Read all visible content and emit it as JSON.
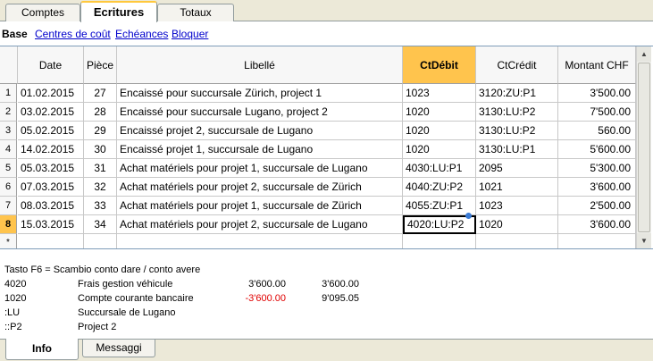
{
  "tabs": [
    {
      "label": "Comptes"
    },
    {
      "label": "Ecritures"
    },
    {
      "label": "Totaux"
    }
  ],
  "views": [
    {
      "label": "Base"
    },
    {
      "label": "Centres de coût"
    },
    {
      "label": "Echéances"
    },
    {
      "label": "Bloquer"
    }
  ],
  "columns": [
    "Date",
    "Pièce",
    "Libellé",
    "CtDébit",
    "CtCrédit",
    "Montant CHF"
  ],
  "rows": [
    {
      "n": "1",
      "date": "01.02.2015",
      "piece": "27",
      "libelle": "Encaissé pour succursale Zürich, project 1",
      "debit": "1023",
      "credit": "3120:ZU:P1",
      "montant": "3'500.00"
    },
    {
      "n": "2",
      "date": "03.02.2015",
      "piece": "28",
      "libelle": "Encaissé pour succursale Lugano, project 2",
      "debit": "1020",
      "credit": "3130:LU:P2",
      "montant": "7'500.00"
    },
    {
      "n": "3",
      "date": "05.02.2015",
      "piece": "29",
      "libelle": "Encaissé projet 2, succursale de Lugano",
      "debit": "1020",
      "credit": "3130:LU:P2",
      "montant": "560.00"
    },
    {
      "n": "4",
      "date": "14.02.2015",
      "piece": "30",
      "libelle": "Encaissé projet 1, succursale de Lugano",
      "debit": "1020",
      "credit": "3130:LU:P1",
      "montant": "5'600.00"
    },
    {
      "n": "5",
      "date": "05.03.2015",
      "piece": "31",
      "libelle": "Achat matériels pour projet 1, succursale de Lugano",
      "debit": "4030:LU:P1",
      "credit": "2095",
      "montant": "5'300.00"
    },
    {
      "n": "6",
      "date": "07.03.2015",
      "piece": "32",
      "libelle": "Achat matériels pour projet 2, succursale de Zürich",
      "debit": "4040:ZU:P2",
      "credit": "1021",
      "montant": "3'600.00"
    },
    {
      "n": "7",
      "date": "08.03.2015",
      "piece": "33",
      "libelle": "Achat matériels pour projet 1, succursale de Zürich",
      "debit": "4055:ZU:P1",
      "credit": "1023",
      "montant": "2'500.00"
    },
    {
      "n": "8",
      "date": "15.03.2015",
      "piece": "34",
      "libelle": "Achat matériels pour projet 2, succursale de Lugano",
      "debit": "4020:LU:P2",
      "credit": "1020",
      "montant": "3'600.00"
    }
  ],
  "new_row_marker": "*",
  "info": {
    "hint": "Tasto F6 = Scambio conto dare / conto avere",
    "lines": [
      {
        "code": "4020",
        "desc": "Frais gestion véhicule",
        "amount": "3'600.00",
        "balance": "3'600.00",
        "neg": false
      },
      {
        "code": "1020",
        "desc": "Compte courante bancaire",
        "amount": "-3'600.00",
        "balance": "9'095.05",
        "neg": true
      },
      {
        "code": ":LU",
        "desc": "Succursale de Lugano",
        "amount": "",
        "balance": "",
        "neg": false
      },
      {
        "code": "::P2",
        "desc": "Project 2",
        "amount": "",
        "balance": "",
        "neg": false
      }
    ]
  },
  "bottom_tabs": [
    {
      "label": "Info"
    },
    {
      "label": "Messaggi"
    }
  ],
  "colors": {
    "selected": "#ffc44d",
    "negative": "#e00000",
    "link": "#0000cc"
  }
}
